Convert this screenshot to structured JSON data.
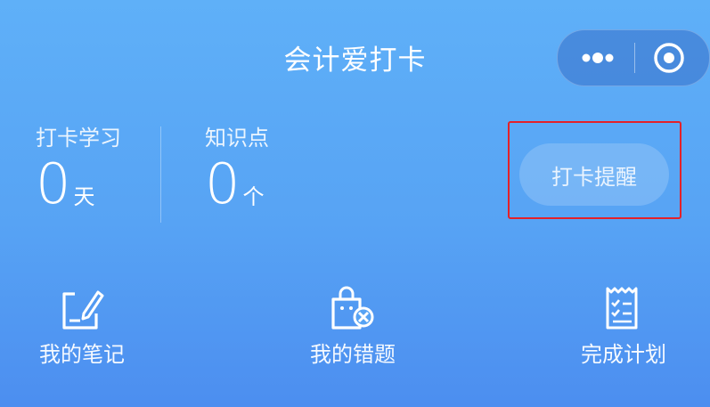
{
  "header": {
    "title": "会计爱打卡",
    "more_icon": "more-dots-icon",
    "close_icon": "record-target-icon"
  },
  "stats": [
    {
      "label": "打卡学习",
      "value": "0",
      "unit": "天"
    },
    {
      "label": "知识点",
      "value": "0",
      "unit": "个"
    }
  ],
  "reminder": {
    "label": "打卡提醒"
  },
  "nav": [
    {
      "label": "我的笔记",
      "icon": "notes-edit-icon"
    },
    {
      "label": "我的错题",
      "icon": "wrong-questions-bag-icon"
    },
    {
      "label": "完成计划",
      "icon": "checklist-plan-icon"
    }
  ],
  "colors": {
    "background_top": "#5fb0f8",
    "background_bottom": "#4c8ef0",
    "highlight_border": "#e32129"
  }
}
